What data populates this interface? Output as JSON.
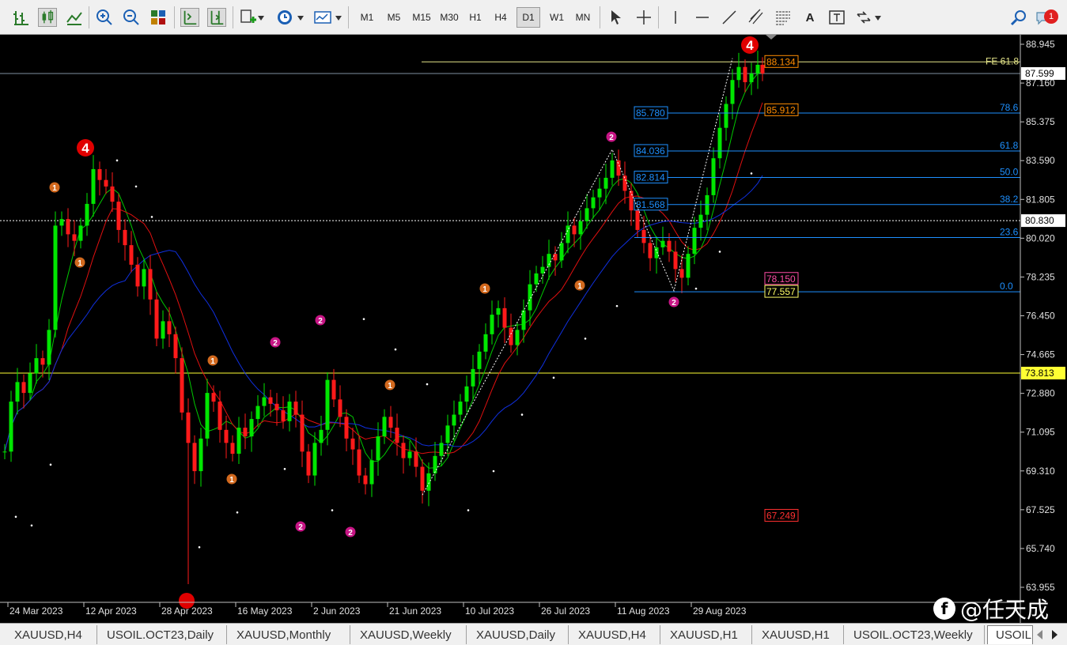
{
  "toolbar": {
    "timeframes": [
      "M1",
      "M5",
      "M15",
      "M30",
      "H1",
      "H4",
      "D1",
      "W1",
      "MN"
    ],
    "selected_timeframe": "D1",
    "notification_count": "1",
    "text_tool": "A"
  },
  "price_axis": {
    "ticks": [
      "88.945",
      "87.160",
      "85.375",
      "83.590",
      "81.805",
      "80.020",
      "78.235",
      "76.450",
      "74.665",
      "72.880",
      "71.095",
      "69.310",
      "67.525",
      "65.740",
      "63.955"
    ],
    "current_price": "87.599",
    "hline1": "80.830",
    "hline2": "73.813"
  },
  "time_axis": {
    "labels": [
      "24 Mar 2023",
      "12 Apr 2023",
      "28 Apr 2023",
      "16 May 2023",
      "2 Jun 2023",
      "21 Jun 2023",
      "10 Jul 2023",
      "26 Jul 2023",
      "11 Aug 2023",
      "29 Aug 2023"
    ]
  },
  "fib_levels": {
    "labels": [
      "FE 61.8",
      "78.6",
      "61.8",
      "50.0",
      "38.2",
      "23.6",
      "0.0"
    ],
    "retrace_prices": [
      "85.780",
      "84.036",
      "82.814",
      "81.568"
    ],
    "expansion_prices": [
      "88.134",
      "85.912",
      "78.150",
      "77.557",
      "67.249"
    ]
  },
  "wave_labels": {
    "big": [
      "4",
      "4"
    ],
    "small": [
      "1",
      "1",
      "2",
      "1",
      "2",
      "1",
      "2",
      "2",
      "1",
      "1",
      "2",
      "1",
      "2"
    ]
  },
  "tabs": [
    "XAUUSD,H4",
    "USOIL.OCT23,Daily",
    "XAUUSD,Monthly",
    "XAUUSD,Weekly",
    "XAUUSD,Daily",
    "XAUUSD,H4",
    "XAUUSD,H1",
    "XAUUSD,H1",
    "USOIL.OCT23,Weekly",
    "USOIL"
  ],
  "active_tab": "USOIL",
  "watermark": "@任天成",
  "colors": {
    "bull": "#00e600",
    "bear": "#ff1a1a",
    "fib": "#1e90ff",
    "fe": "#ffd700",
    "wave_orange": "#d2691e",
    "wave_magenta": "#c71585"
  }
}
